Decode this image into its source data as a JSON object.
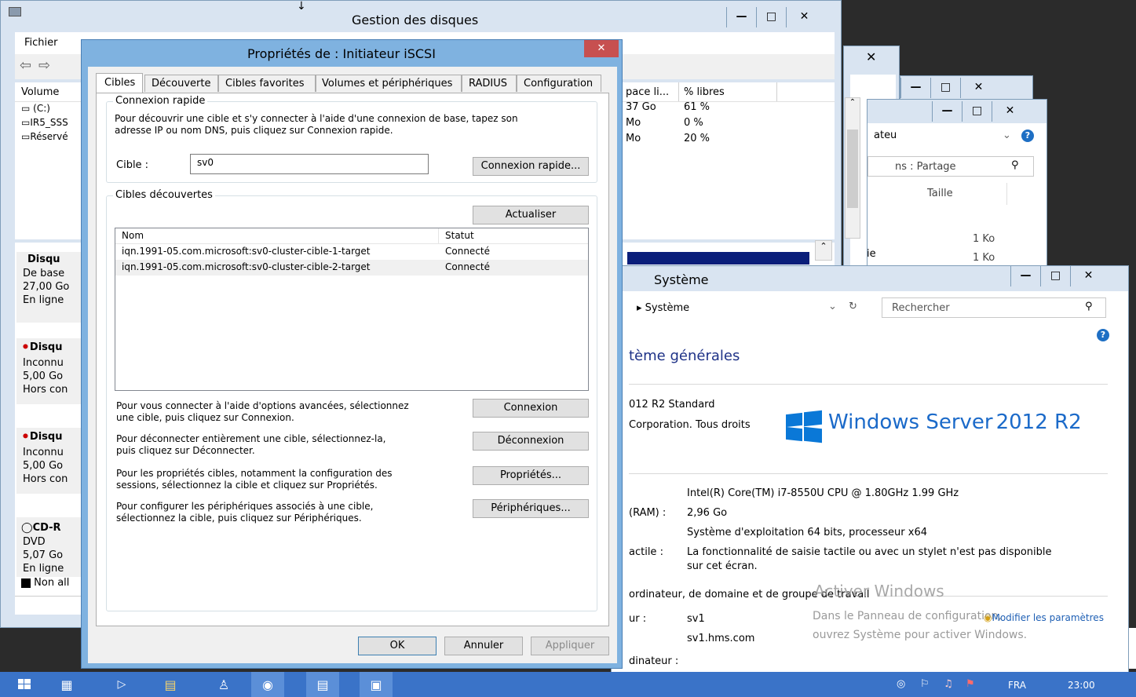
{
  "disk_mgmt": {
    "title": "Gestion des disques",
    "menu_file": "Fichier",
    "col_volume": "Volume",
    "col_free": "pace li...",
    "col_pct": "% libres",
    "volumes": [
      {
        "name": "(C:)",
        "free": "37 Go",
        "pct": "61 %"
      },
      {
        "name": "IR5_SSS",
        "free": "Mo",
        "pct": "0 %"
      },
      {
        "name": "Réservé",
        "free": "Mo",
        "pct": "20 %"
      }
    ],
    "disks": [
      {
        "name": "Disqu",
        "l1": "De base",
        "l2": "27,00 Go",
        "l3": "En ligne"
      },
      {
        "name": "Disqu",
        "l1": "Inconnu",
        "l2": "5,00 Go",
        "l3": "Hors con"
      },
      {
        "name": "Disqu",
        "l1": "Inconnu",
        "l2": "5,00 Go",
        "l3": "Hors con"
      },
      {
        "name": "CD-R",
        "l1": "DVD",
        "l2": "5,07 Go",
        "l3": "En ligne"
      }
    ],
    "legend_unalloc": "Non all"
  },
  "explorer": {
    "frag_ateu": "ateu",
    "search": "ns : Partage",
    "col_size": "Taille",
    "size1": "1 Ko",
    "size2": "1 Ko",
    "frag_e": "ie"
  },
  "system": {
    "title": "Système",
    "breadcrumb": "Système",
    "search_placeholder": "Rechercher",
    "heading": "tème générales",
    "edition": "012 R2 Standard",
    "copyright": "Corporation. Tous droits",
    "logo_text": "Windows Server",
    "logo_ver": "2012 R2",
    "cpu": "Intel(R) Core(TM) i7-8550U CPU @ 1.80GHz   1.99 GHz",
    "ram_label": "(RAM) :",
    "ram": "2,96 Go",
    "systype": "Système d'exploitation 64 bits, processeur x64",
    "pen_label": "actile :",
    "pen1": "La fonctionnalité de saisie tactile ou avec un stylet n'est pas disponible",
    "pen2": "sur cet écran.",
    "section2": "ordinateur, de domaine et de groupe de travail",
    "name_label": "ur :",
    "name": "sv1",
    "fullname": "sv1.hms.com",
    "desc_label": "dinateur :",
    "modify": "Modifier les paramètres",
    "watermark1": "Activer Windows",
    "watermark2": "Dans le Panneau de configuration,",
    "watermark3": "ouvrez Système pour activer Windows."
  },
  "dialog": {
    "title": "Propriétés de : Initiateur iSCSI",
    "tabs": [
      "Cibles",
      "Découverte",
      "Cibles favorites",
      "Volumes et périphériques",
      "RADIUS",
      "Configuration"
    ],
    "quick_group": "Connexion rapide",
    "quick_desc1": "Pour découvrir une cible et s'y connecter à l'aide d'une connexion de base, tapez son",
    "quick_desc2": "adresse IP ou nom DNS, puis cliquez sur Connexion rapide.",
    "target_label": "Cible :",
    "target_value": "sv0",
    "quick_btn": "Connexion rapide...",
    "discovered_group": "Cibles découvertes",
    "refresh_btn": "Actualiser",
    "col_name": "Nom",
    "col_status": "Statut",
    "targets": [
      {
        "name": "iqn.1991-05.com.microsoft:sv0-cluster-cible-1-target",
        "status": "Connecté"
      },
      {
        "name": "iqn.1991-05.com.microsoft:sv0-cluster-cible-2-target",
        "status": "Connecté"
      }
    ],
    "connect_desc1": "Pour vous connecter à l'aide d'options avancées, sélectionnez",
    "connect_desc2": "une cible, puis cliquez sur Connexion.",
    "connect_btn": "Connexion",
    "disconnect_desc1": "Pour déconnecter entièrement une cible, sélectionnez-la,",
    "disconnect_desc2": "puis cliquez sur Déconnecter.",
    "disconnect_btn": "Déconnexion",
    "props_desc1": "Pour les propriétés cibles, notamment la configuration des",
    "props_desc2": "sessions, sélectionnez la cible et cliquez sur Propriétés.",
    "props_btn": "Propriétés...",
    "devices_desc1": "Pour configurer les périphériques associés à une cible,",
    "devices_desc2": "sélectionnez la cible, puis cliquez sur Périphériques.",
    "devices_btn": "Périphériques...",
    "ok": "OK",
    "cancel": "Annuler",
    "apply": "Appliquer"
  },
  "taskbar": {
    "lang": "FRA",
    "clock": "23:00"
  }
}
